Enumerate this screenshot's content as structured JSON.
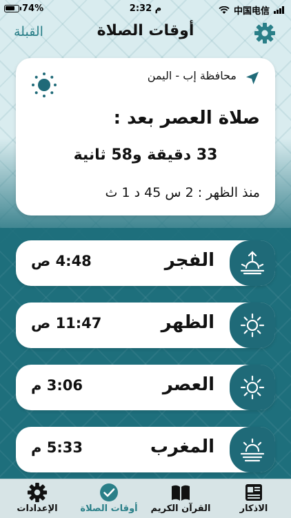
{
  "status_bar": {
    "battery": "74%",
    "battery_level": 0.74,
    "time": "2:32 م",
    "carrier": "中国电信"
  },
  "header": {
    "title": "أوقات الصلاة",
    "qibla_label": "القبلة"
  },
  "main_card": {
    "location": "محافظة إب - اليمن",
    "next_prayer": "صلاة العصر بعد :",
    "countdown": "33 دقيقة و58 ثانية",
    "since": "منذ الظهر : 2 س 45 د 1 ث"
  },
  "prayers": [
    {
      "name": "الفجر",
      "time": "4:48 ص",
      "icon": "sunrise-icon"
    },
    {
      "name": "الظهر",
      "time": "11:47 ص",
      "icon": "sun-icon"
    },
    {
      "name": "العصر",
      "time": "3:06 م",
      "icon": "sun-icon"
    },
    {
      "name": "المغرب",
      "time": "5:33 م",
      "icon": "sunset-icon"
    }
  ],
  "tabs": [
    {
      "label": "الإعدادات",
      "icon": "gear-icon",
      "active": false
    },
    {
      "label": "أوقات الصلاة",
      "icon": "check-circle-icon",
      "active": true
    },
    {
      "label": "القرآن الكريم",
      "icon": "book-icon",
      "active": false
    },
    {
      "label": "الاذكار",
      "icon": "newspaper-icon",
      "active": false
    }
  ],
  "colors": {
    "accent": "#1f6a78",
    "accent_light": "#2a7f88",
    "card": "#ffffff"
  }
}
